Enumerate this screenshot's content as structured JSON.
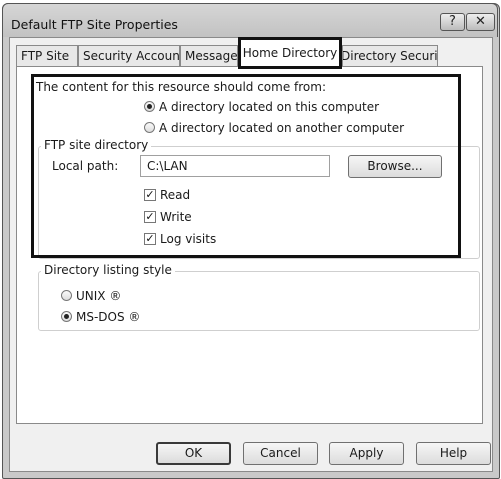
{
  "window": {
    "title": "Default FTP Site Properties",
    "help_button": "?",
    "close_button": "✕"
  },
  "tabs": [
    {
      "label": "FTP Site"
    },
    {
      "label": "Security Accounts"
    },
    {
      "label": "Messages"
    },
    {
      "label": "Home Directory",
      "active": true
    },
    {
      "label": "Directory Security"
    }
  ],
  "content_source": {
    "heading": "The content for this resource should come from:",
    "options": [
      {
        "label": "A directory located on this computer",
        "selected": true
      },
      {
        "label": "A directory located on another computer",
        "selected": false
      }
    ]
  },
  "ftp_site_directory": {
    "legend": "FTP site directory",
    "local_path_label": "Local path:",
    "local_path_value": "C:\\LAN",
    "browse_button": "Browse...",
    "permissions": [
      {
        "label": "Read",
        "checked": true
      },
      {
        "label": "Write",
        "checked": true
      },
      {
        "label": "Log visits",
        "checked": true
      }
    ]
  },
  "listing_style": {
    "legend": "Directory listing style",
    "options": [
      {
        "label": "UNIX ®",
        "selected": false
      },
      {
        "label": "MS-DOS ®",
        "selected": true
      }
    ]
  },
  "footer": {
    "ok": "OK",
    "cancel": "Cancel",
    "apply": "Apply",
    "help": "Help"
  }
}
